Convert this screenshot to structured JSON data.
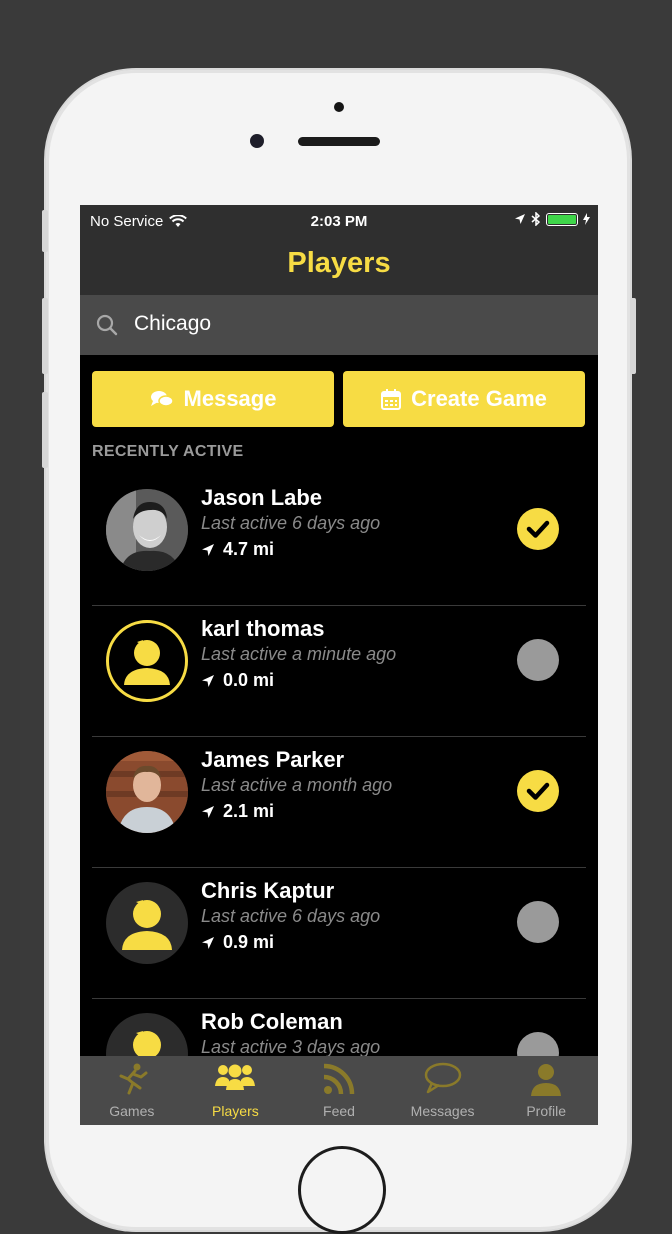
{
  "colors": {
    "accent": "#f7dc44",
    "background": "#000000",
    "bar": "#2f2f2f",
    "inactive": "#9a9a9a"
  },
  "status_bar": {
    "carrier": "No Service",
    "time": "2:03 PM"
  },
  "nav": {
    "title": "Players"
  },
  "search": {
    "value": "Chicago",
    "icon": "search-icon"
  },
  "actions": {
    "message": {
      "label": "Message",
      "icon": "chat-icon"
    },
    "create_game": {
      "label": "Create Game",
      "icon": "calendar-icon"
    }
  },
  "section_label": "RECENTLY ACTIVE",
  "players": [
    {
      "name": "Jason Labe",
      "last_active": "Last active 6 days ago",
      "distance": "4.7 mi",
      "selected": true,
      "avatar": "photo"
    },
    {
      "name": "karl thomas",
      "last_active": "Last active a minute ago",
      "distance": "0.0 mi",
      "selected": false,
      "avatar": "placeholder-outlined"
    },
    {
      "name": "James Parker",
      "last_active": "Last active a month ago",
      "distance": "2.1 mi",
      "selected": true,
      "avatar": "photo"
    },
    {
      "name": "Chris Kaptur",
      "last_active": "Last active 6 days ago",
      "distance": "0.9 mi",
      "selected": false,
      "avatar": "placeholder"
    },
    {
      "name": "Rob Coleman",
      "last_active": "Last active 3 days ago",
      "distance": "",
      "selected": false,
      "avatar": "placeholder"
    }
  ],
  "tabs": [
    {
      "label": "Games",
      "icon": "runner-icon",
      "selected": false
    },
    {
      "label": "Players",
      "icon": "group-icon",
      "selected": true
    },
    {
      "label": "Feed",
      "icon": "rss-icon",
      "selected": false
    },
    {
      "label": "Messages",
      "icon": "speech-bubble-icon",
      "selected": false
    },
    {
      "label": "Profile",
      "icon": "person-icon",
      "selected": false
    }
  ]
}
